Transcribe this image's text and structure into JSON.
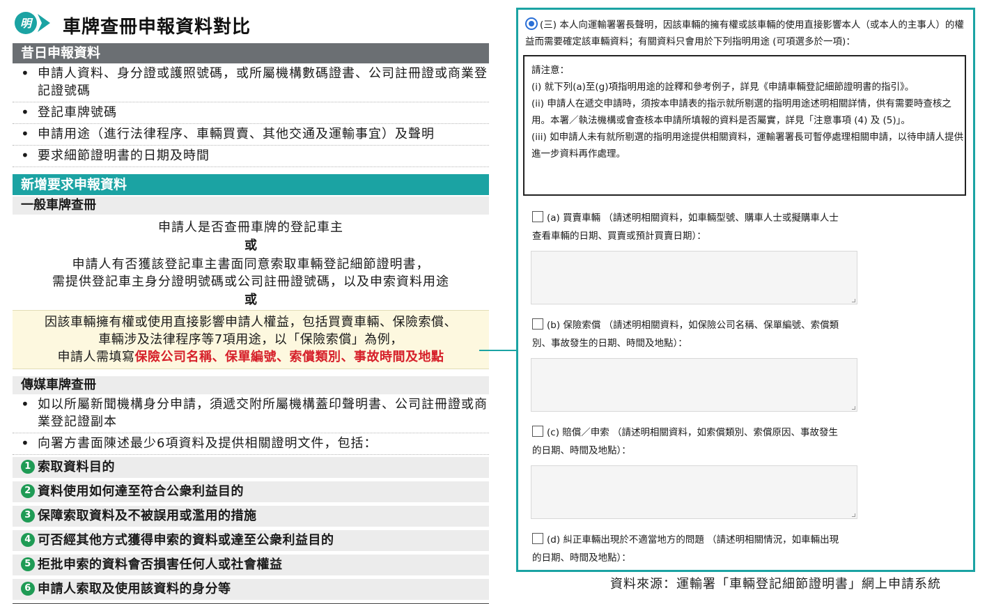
{
  "header": {
    "logo_text": "明",
    "title": "車牌查冊申報資料對比"
  },
  "past": {
    "heading": "昔日申報資料",
    "items": [
      "申請人資料、身分證或護照號碼，或所屬機構數碼證書、公司註冊證或商業登記證號碼",
      "登記車牌號碼",
      "申請用途（進行法律程序、車輛買賣、其他交通及運輸事宜）及聲明",
      "要求細節證明書的日期及時間"
    ]
  },
  "new": {
    "heading": "新增要求申報資料",
    "general": {
      "heading": "一般車牌查冊",
      "line1": "申請人是否查冊車牌的登記車主",
      "or1": "或",
      "line2a": "申請人有否獲該登記車主書面同意索取車輛登記細節證明書，",
      "line2b": "需提供登記車主身分證明號碼或公司註冊證號碼，以及申索資料用途",
      "or2": "或",
      "hl_a": "因該車輛擁有權或使用直接影響申請人權益，包括買賣車輛、保險索償、",
      "hl_b": "車輛涉及法律程序等7項用途，以「保險索償」為例，",
      "hl_c_prefix": "申請人需填寫",
      "hl_c_red": "保險公司名稱、保單編號、索償類別、事故時間及地點"
    },
    "media": {
      "heading": "傳媒車牌查冊",
      "items": [
        "如以所屬新聞機構身分申請，須遞交附所屬機構蓋印聲明書、公司註冊證或商業登記證副本",
        "向署方書面陳述最少6項資料及提供相關證明文件，包括："
      ],
      "numbered": [
        {
          "n": "1",
          "text": "索取資料目的"
        },
        {
          "n": "2",
          "text": "資料使用如何達至符合公衆利益目的"
        },
        {
          "n": "3",
          "text": "保障索取資料及不被誤用或濫用的措施"
        },
        {
          "n": "4",
          "text": "可否經其他方式獲得申索的資料或達至公衆利益目的"
        },
        {
          "n": "5",
          "text": "拒批申索的資料會否損害任何人或社會權益"
        },
        {
          "n": "6",
          "text": "申請人索取及使用該資料的身分等"
        }
      ]
    }
  },
  "form": {
    "intro": "(三) 本人向運輸署署長聲明，因該車輛的擁有權或該車輛的使用直接影響本人（或本人的主事人）的權益而需要確定該車輛資料；有關資料只會用於下列指明用途 (可項選多於一項)：",
    "notice_title": "請注意：",
    "notice_i": "(i) 就下列(a)至(g)項指明用途的詮釋和參考例子，詳見《申請車輛登記細節證明書的指引》。",
    "notice_ii": "(ii) 申請人在遞交申請時，須按本申請表的指示就所剔選的指明用途述明相關詳情，供有需要時查核之用。本署／執法機構或會查核本申請所填報的資料是否屬實，詳見「注意事項 (4) 及 (5)」。",
    "notice_iii": "(iii) 如申請人未有就所剔選的指明用途提供相關資料，運輸署署長可暫停處理相關申請，以待申請人提供進一步資料再作處理。",
    "options": [
      {
        "a": "(a) 買賣車輛 （請述明相關資料，如車輛型號、購車人士或擬購車人士",
        "b": "查看車輛的日期、買賣或預計買賣日期）："
      },
      {
        "a": "(b) 保險索償 （請述明相關資料，如保險公司名稱、保單編號、索償類",
        "b": "別、事故發生的日期、時間及地點）："
      },
      {
        "a": "(c) 賠償／申索 （請述明相關資料，如索償類別、索償原因、事故發生",
        "b": "的日期、時間及地點）："
      },
      {
        "a": "(d) 糾正車輛出現於不適當地方的問題 （請述明相關情況，如車輛出現",
        "b": "的日期、時間及地點）："
      }
    ]
  },
  "source": "資料來源：運輸署「車輛登記細節證明書」網上申請系統"
}
